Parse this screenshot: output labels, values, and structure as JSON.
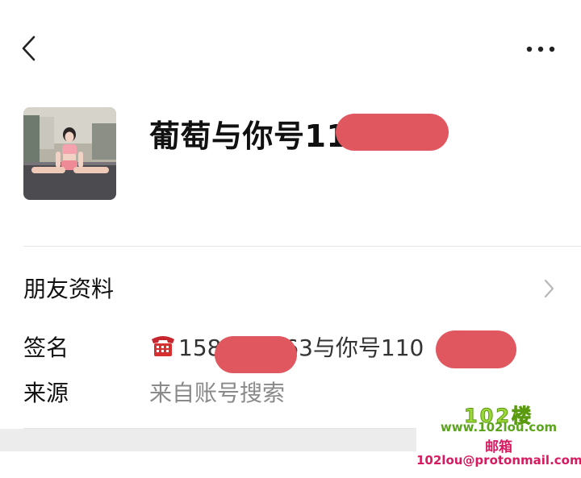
{
  "header": {
    "back_icon": "chevron-left-icon",
    "more_icon": "more-dots-icon"
  },
  "profile": {
    "name": "葡萄与你号11",
    "avatar_icon": "avatar-photo"
  },
  "friend_info": {
    "title": "朋友资料",
    "chevron_icon": "chevron-right-icon"
  },
  "signature": {
    "label": "签名",
    "phone_icon": "telephone-icon",
    "value_start": "158",
    "value_mid": "363与你号110"
  },
  "source": {
    "label": "来源",
    "value": "来自账号搜索"
  },
  "watermark": {
    "logo": "102楼",
    "site": "www.102lou.com",
    "mail_label": "邮箱",
    "email": "102lou@protonmail.com"
  },
  "colors": {
    "redaction": "#e0575f",
    "divider": "#e5e5e5",
    "secondary_text": "#8a8a8a",
    "watermark_green": "#5aa51c",
    "watermark_pink": "#d81b60"
  }
}
